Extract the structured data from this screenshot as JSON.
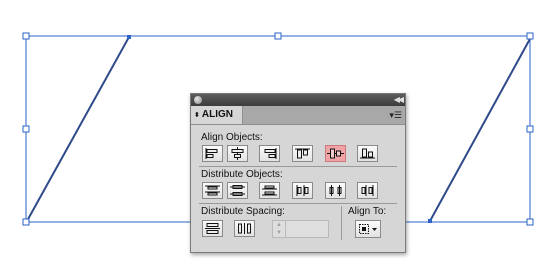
{
  "panel": {
    "tab_label": "ALIGN",
    "sections": {
      "align_objects": "Align Objects:",
      "distribute_objects": "Distribute Objects:",
      "distribute_spacing": "Distribute Spacing:",
      "align_to": "Align To:"
    },
    "align_buttons": [
      "horizontal-align-left-icon",
      "horizontal-align-center-icon",
      "horizontal-align-right-icon",
      "vertical-align-top-icon",
      "vertical-align-center-icon",
      "vertical-align-bottom-icon"
    ],
    "active_button": "vertical-align-center-icon",
    "distribute_buttons": [
      "vertical-distribute-top-icon",
      "vertical-distribute-center-icon",
      "vertical-distribute-bottom-icon",
      "horizontal-distribute-left-icon",
      "horizontal-distribute-center-icon",
      "horizontal-distribute-right-icon"
    ],
    "spacing_buttons": [
      "vertical-distribute-space-icon",
      "horizontal-distribute-space-icon"
    ],
    "spacing_value": "",
    "align_to_icon": "align-to-selection-icon"
  },
  "colors": {
    "selection": "#2b63c9",
    "shape_stroke": "#2e4a8a",
    "active_button": "#f2a3a5",
    "panel_bg": "#d6d6d6"
  }
}
